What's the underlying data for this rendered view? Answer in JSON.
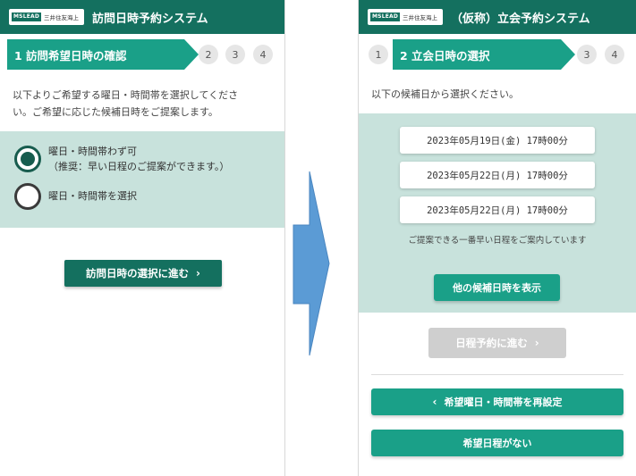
{
  "colors": {
    "header": "#14705f",
    "accent": "#1aa088",
    "panel_bg": "#c8e2dc",
    "arrow": "#5b9bd5",
    "disabled": "#cfcfcf"
  },
  "left": {
    "logo_mark": "MSLEAD",
    "logo_text": "三井住友海上",
    "title": "訪問日時予約システム",
    "active_step": "1 訪問希望日時の確認",
    "steps": [
      "2",
      "3",
      "4"
    ],
    "intro_line1": "以下よりご希望する曜日・時間帯を選択してくださ",
    "intro_line2": "い。ご希望に応じた候補日時をご提案します。",
    "option1_line1": "曜日・時間帯わず可",
    "option1_line2": "（推奨：早い日程のご提案ができます。）",
    "option2": "曜日・時間帯を選択",
    "next_button": "訪問日時の選択に進む",
    "chevron": "›"
  },
  "right": {
    "logo_mark": "MSLEAD",
    "logo_text": "三井住友海上",
    "title": "（仮称）立会予約システム",
    "step_before": "1",
    "active_step": "2 立会日時の選択",
    "steps": [
      "3",
      "4"
    ],
    "intro": "以下の候補日から選択ください。",
    "dates": [
      "2023年05月19日(金) 17時00分",
      "2023年05月22日(月) 17時00分",
      "2023年05月22日(月) 17時00分"
    ],
    "note": "ご提案できる一番早い日程をご案内しています",
    "other_dates_button": "他の候補日時を表示",
    "reserve_button": "日程予約に進む",
    "reset_button": "希望曜日・時間帯を再設定",
    "no_date_button": "希望日程がない",
    "chevron_right": "›",
    "chevron_left": "‹"
  }
}
